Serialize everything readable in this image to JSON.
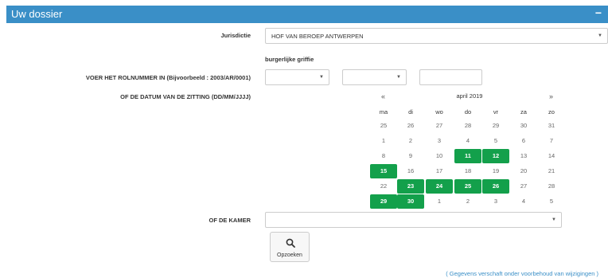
{
  "header": {
    "title": "Uw dossier",
    "toggle": "−"
  },
  "jurisdictie": {
    "label": "Jurisdictie",
    "value": "HOF VAN BEROEP ANTWERPEN"
  },
  "griffie": {
    "label": "burgerlijke griffie"
  },
  "rolnummer": {
    "label": "VOER HET ROLNUMMER IN (Bijvoorbeeld : 2003/AR/0001)"
  },
  "datum": {
    "label": "OF DE DATUM VAN DE ZITTING (DD/MM/JJJJ)"
  },
  "calendar": {
    "month": "april 2019",
    "prev": "«",
    "next": "»",
    "weekdays": [
      "ma",
      "di",
      "wo",
      "do",
      "vr",
      "za",
      "zo"
    ],
    "weeks": [
      [
        "25",
        "26",
        "27",
        "28",
        "29",
        "30",
        "31"
      ],
      [
        "1",
        "2",
        "3",
        "4",
        "5",
        "6",
        "7"
      ],
      [
        "8",
        "9",
        "10",
        "11",
        "12",
        "13",
        "14"
      ],
      [
        "15",
        "16",
        "17",
        "18",
        "19",
        "20",
        "21"
      ],
      [
        "22",
        "23",
        "24",
        "25",
        "26",
        "27",
        "28"
      ],
      [
        "29",
        "30",
        "1",
        "2",
        "3",
        "4",
        "5"
      ]
    ],
    "highlighted": [
      "11",
      "12",
      "15",
      "23",
      "24",
      "25",
      "26",
      "29",
      "30"
    ]
  },
  "kamer": {
    "label": "OF DE KAMER"
  },
  "search_button": {
    "label": "Opzoeken"
  },
  "footer": {
    "text": "( Gegevens verschaft onder voorbehoud van wijzigingen )"
  },
  "colors": {
    "header": "#3a8fc7",
    "highlight": "#13a04b"
  }
}
